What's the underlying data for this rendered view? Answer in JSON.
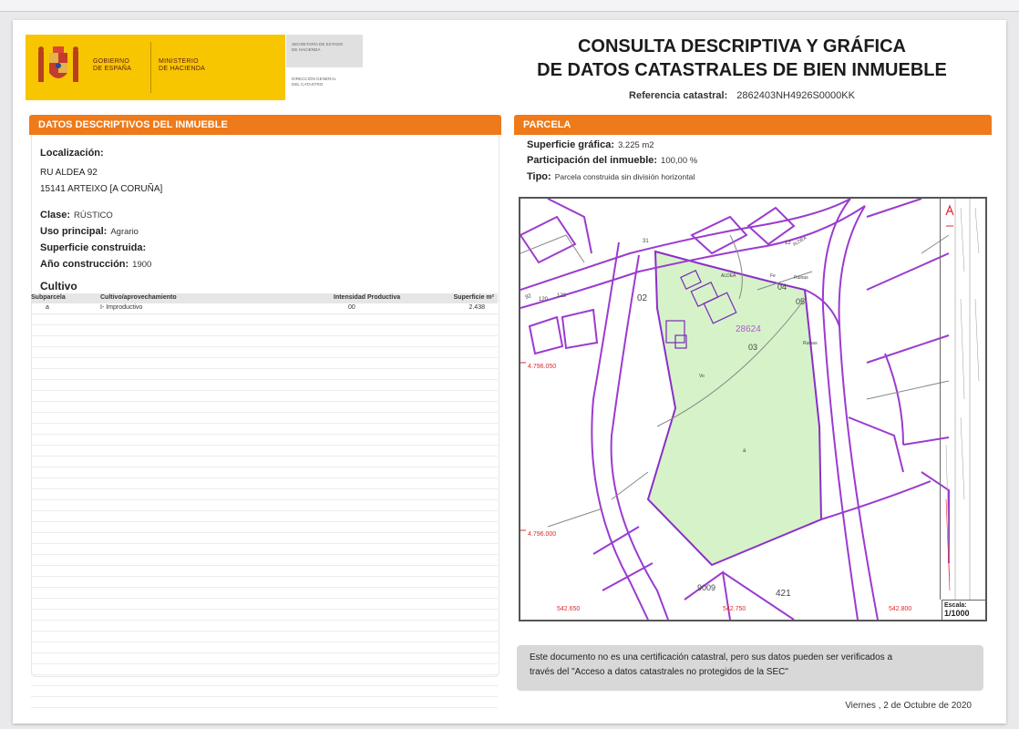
{
  "header": {
    "gobierno": "GOBIERNO\nDE ESPAÑA",
    "ministerio": "MINISTERIO\nDE HACIENDA",
    "secretaria": "SECRETARÍA DE ESTADO\nDE HACIENDA",
    "direccion": "DIRECCIÓN GENERAL\nDEL CATASTRO",
    "title_line1": "CONSULTA DESCRIPTIVA Y GRÁFICA",
    "title_line2": "DE DATOS CATASTRALES DE BIEN INMUEBLE",
    "ref_label": "Referencia catastral:",
    "ref_value": "2862403NH4926S0000KK"
  },
  "left": {
    "section_title": "DATOS DESCRIPTIVOS DEL INMUEBLE",
    "localizacion_label": "Localización:",
    "address_line1": "RU ALDEA 92",
    "address_line2": "15141 ARTEIXO [A CORUÑA]",
    "clase_label": "Clase:",
    "clase_value": "RÚSTICO",
    "uso_label": "Uso principal:",
    "uso_value": "Agrario",
    "superficie_label": "Superficie construida:",
    "superficie_value": "",
    "anio_label": "Año construcción:",
    "anio_value": "1900",
    "cultivo_label": "Cultivo",
    "table_headers": [
      "Subparcela",
      "Cultivo/aprovechamiento",
      "Intensidad Productiva",
      "Superficie m²"
    ],
    "table_rows": [
      [
        "a",
        "I- Improductivo",
        "00",
        "2.438"
      ]
    ]
  },
  "right": {
    "section_title": "PARCELA",
    "sup_grafica_label": "Superficie gráfica:",
    "sup_grafica_value": "3.225 m2",
    "participacion_label": "Participación del inmueble:",
    "participacion_value": "100,00 %",
    "tipo_label": "Tipo:",
    "tipo_value": "Parcela construida sin división horizontal"
  },
  "map": {
    "coord_y1": "4.796.050",
    "coord_y2": "4.796.000",
    "coord_x1": "542.650",
    "coord_x2": "542.750",
    "coord_x3": "542.800",
    "parcel_ref": "28624",
    "labels": {
      "p02": "02",
      "p03": "03",
      "p04": "04",
      "p05": "05",
      "p9009": "9009",
      "p421": "421",
      "a_sub": "a",
      "road": "ALDEA",
      "road2": "ALDEA",
      "fe": "Fe",
      "ruinas": "Ruinas",
      "ruinas2": "Ruinas",
      "vo": "Vo",
      "n31": "31",
      "n92": "92",
      "n120": "120",
      "n123": "123",
      "n12": "12"
    },
    "escala_label": "Escala:",
    "escala_value": "1/1000"
  },
  "notice": {
    "line1": "Este documento no es una certificación catastral, pero sus datos pueden ser verificados a",
    "line2": "través del \"Acceso a datos catastrales no protegidos de la SEC\""
  },
  "footer": {
    "date": "Viernes , 2 de Octubre de 2020"
  },
  "colors": {
    "orange": "#ee7a1a",
    "yellow": "#f7c600",
    "parcel_fill": "#d6f2c9",
    "boundary": "#9b3bd0",
    "coord_red": "#e0292b"
  }
}
